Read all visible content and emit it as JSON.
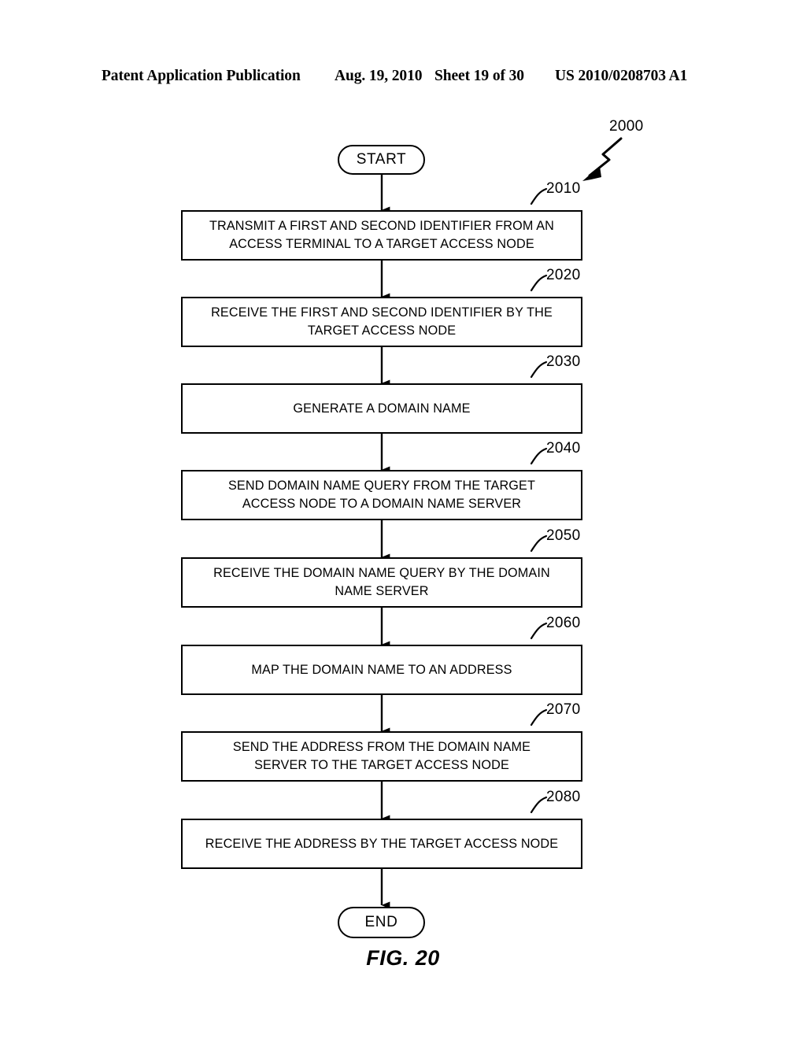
{
  "header": {
    "publication": "Patent Application Publication",
    "date": "Aug. 19, 2010",
    "sheet": "Sheet 19 of 30",
    "patent_number": "US 2010/0208703 A1"
  },
  "figure": {
    "caption": "FIG. 20",
    "diagram_ref": "2000"
  },
  "flowchart": {
    "start_label": "START",
    "end_label": "END",
    "steps": [
      {
        "ref": "2010",
        "line1": "TRANSMIT A FIRST AND SECOND IDENTIFIER FROM AN",
        "line2": "ACCESS TERMINAL TO A TARGET ACCESS NODE"
      },
      {
        "ref": "2020",
        "line1": "RECEIVE THE FIRST AND SECOND IDENTIFIER BY THE",
        "line2": "TARGET ACCESS NODE"
      },
      {
        "ref": "2030",
        "line1": "GENERATE A DOMAIN NAME",
        "line2": ""
      },
      {
        "ref": "2040",
        "line1": "SEND DOMAIN NAME QUERY FROM THE TARGET",
        "line2": "ACCESS NODE TO A DOMAIN NAME SERVER"
      },
      {
        "ref": "2050",
        "line1": "RECEIVE THE DOMAIN NAME QUERY BY THE DOMAIN",
        "line2": "NAME SERVER"
      },
      {
        "ref": "2060",
        "line1": "MAP THE DOMAIN NAME TO AN ADDRESS",
        "line2": ""
      },
      {
        "ref": "2070",
        "line1": "SEND THE ADDRESS FROM THE DOMAIN NAME",
        "line2": "SERVER TO THE TARGET ACCESS NODE"
      },
      {
        "ref": "2080",
        "line1": "RECEIVE THE ADDRESS BY THE TARGET ACCESS NODE",
        "line2": ""
      }
    ]
  },
  "style": {
    "ink": "#000000",
    "paper": "#ffffff"
  }
}
